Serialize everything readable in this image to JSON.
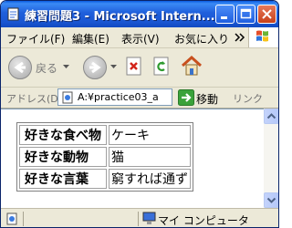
{
  "window": {
    "title": "練習問題3 - Microsoft Intern..."
  },
  "menu": {
    "items": [
      "ファイル(F)",
      "編集(E)",
      "表示(V)",
      "お気に入り"
    ]
  },
  "toolbar": {
    "back_label": "戻る"
  },
  "address": {
    "label": "アドレス(D)",
    "value": "A:¥practice03_a",
    "go_label": "移動",
    "links_label": "リンク"
  },
  "table": {
    "rows": [
      {
        "label": "好きな食べ物",
        "value": "ケーキ"
      },
      {
        "label": "好きな動物",
        "value": "猫"
      },
      {
        "label": "好きな言葉",
        "value": "窮すれば通ず"
      }
    ]
  },
  "status": {
    "zone": "マイ コンピュータ"
  }
}
